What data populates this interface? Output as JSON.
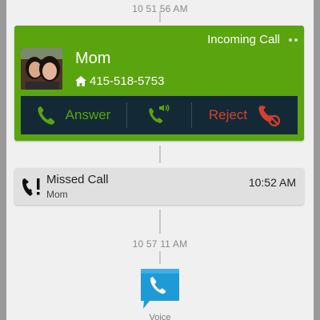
{
  "timeline": {
    "time_1": "10 51 56 AM",
    "time_2": "10 57 11 AM"
  },
  "incoming_call": {
    "status": "Incoming Call",
    "contact_name": "Mom",
    "phone_number": "415-518-5753",
    "answer_label": "Answer",
    "reject_label": "Reject",
    "icons": [
      "home-icon",
      "phone-answer-icon",
      "speakerphone-icon",
      "phone-reject-icon"
    ],
    "colors": {
      "card": "#5aa40f",
      "action_bar": "#132a36",
      "answer": "#5aa40f",
      "reject": "#d5402b"
    }
  },
  "missed_call": {
    "title": "Missed Call",
    "contact": "Mom",
    "time": "10:52 AM",
    "icon": "missed-call-icon"
  },
  "voice_app": {
    "label": "Voice",
    "icon": "google-voice-icon",
    "color": "#1e9ad6"
  }
}
